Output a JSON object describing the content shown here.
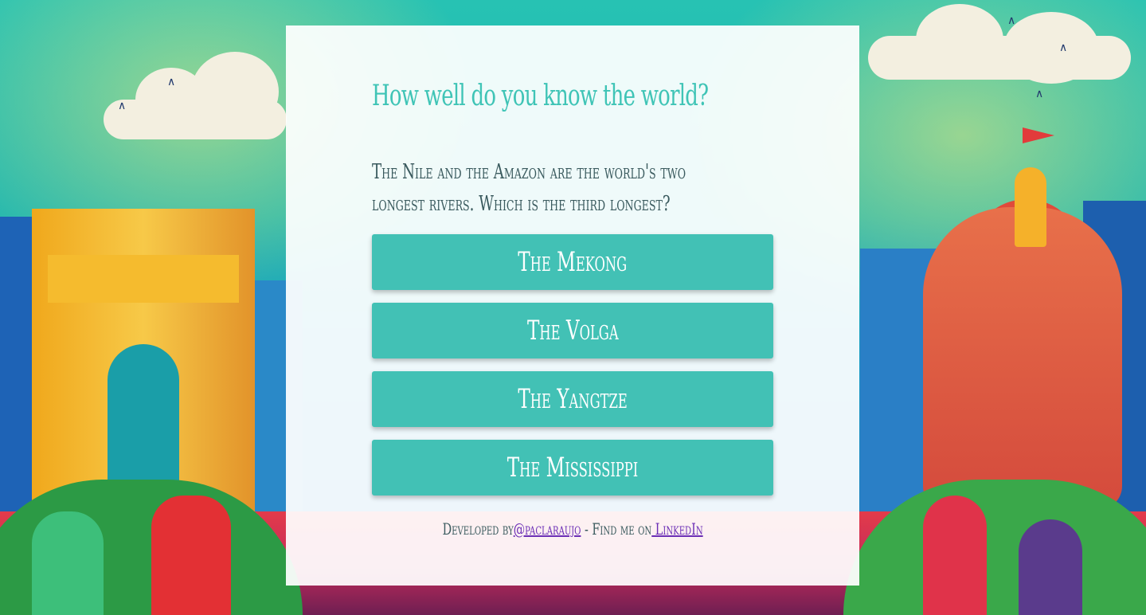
{
  "quiz": {
    "title": "How well do you know the world?",
    "question": "The Nile and the Amazon are the world's two longest rivers. Which is the third longest?",
    "answers": [
      {
        "label": "The Mekong"
      },
      {
        "label": "The Volga"
      },
      {
        "label": "The Yangtze"
      },
      {
        "label": "The Mississippi"
      }
    ]
  },
  "footer": {
    "developed_by": "Developed by",
    "handle_link": "@paclaraujo",
    "find_me": " - Find me on",
    "linkedin_link": " LinkedIn"
  },
  "colors": {
    "accent": "#42c1b5",
    "title": "#3fc4b6",
    "text": "#3a5a5e",
    "link": "#6a2db5",
    "card": "#ffffff"
  },
  "icons": {
    "background": "india-illustration-background"
  }
}
